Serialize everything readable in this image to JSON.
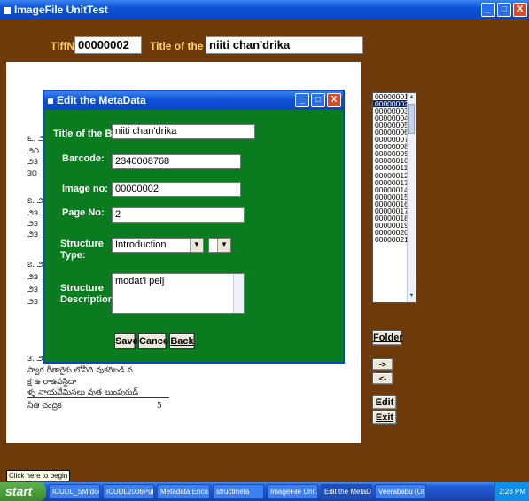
{
  "window": {
    "title": "ImageFile UnitTest"
  },
  "header": {
    "tiff_label": "TiffNo",
    "tiff_value": "00000002",
    "book_label": "Title of the Book",
    "book_value": "niiti chan'drika"
  },
  "document_lines": [
    "౬. ౨",
    "౨౦",
    "౨౩",
    "౩౦",
    "౭. ౨౩",
    "౨౩",
    "౨౩",
    "౨౩",
    "౭. ౨౩",
    "౨౩",
    "౨౩",
    "౨౩",
    "౩. ౨౩ ____",
    "స్వార రీతాగైకు లోనీది వుకరిబడి న",
    "క్ష ఉ రాఉపస్థిదా",
    "ళ్ళ నాయవేమినలు వుత బుంపురుడ్",
    "నీతి చంద్రిక"
  ],
  "page_num_right": "5",
  "list": {
    "items": [
      "00000001",
      "00000002",
      "00000003",
      "00000004",
      "00000005",
      "00000006",
      "00000007",
      "00000008",
      "00000009",
      "00000010",
      "00000011",
      "00000012",
      "00000013",
      "00000014",
      "00000015",
      "00000016",
      "00000017",
      "00000018",
      "00000019",
      "00000020",
      "00000021"
    ],
    "selected_index": 1
  },
  "side_buttons": {
    "folder": "Folder",
    "next": "->",
    "prev": "<-",
    "edit": "Edit",
    "exit": "Exit"
  },
  "dialog": {
    "title": "Edit the MetaData",
    "title_label": "Title of the Book :",
    "title_value": "niiti chan'drika",
    "barcode_label": "Barcode:",
    "barcode_value": "2340008768",
    "image_label": "Image no:",
    "image_value": "00000002",
    "page_label": "Page No:",
    "page_value": "2",
    "structure_type_label1": "Structure",
    "structure_type_label2": "Type:",
    "structure_type_value": "Introduction",
    "structure_desc_label1": "Structure",
    "structure_desc_label2": "Description:",
    "structure_desc_value": "modat'i peij",
    "save": "Save",
    "cancel": "Cancel",
    "back": "Back"
  },
  "tooltip": "Click here to begin",
  "taskbar": {
    "start": "start",
    "tasks": [
      "ICUDL_SM.doc...",
      "ICUDL2006Pub...",
      "Metadata Enco...",
      "structmeta",
      "ImageFile Unit...",
      "Edit the MetaD...",
      "Veerababu (Of..."
    ],
    "active_index": 5,
    "clock": "2:23 PM"
  }
}
